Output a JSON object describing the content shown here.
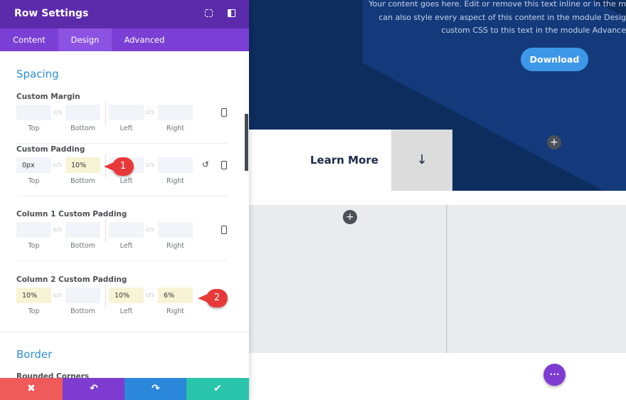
{
  "panel": {
    "title": "Row Settings",
    "tabs": [
      {
        "label": "Content"
      },
      {
        "label": "Design"
      },
      {
        "label": "Advanced"
      }
    ],
    "spacing_title": "Spacing",
    "groups": [
      {
        "label": "Custom Margin",
        "values": [
          "",
          "",
          "",
          ""
        ]
      },
      {
        "label": "Custom Padding",
        "values": [
          "0px",
          "10%",
          "",
          ""
        ]
      },
      {
        "label": "Column 1 Custom Padding",
        "values": [
          "",
          "",
          "",
          ""
        ]
      },
      {
        "label": "Column 2 Custom Padding",
        "values": [
          "10%",
          "",
          "10%",
          "6%"
        ]
      }
    ],
    "sides": [
      "Top",
      "Bottom",
      "Left",
      "Right"
    ],
    "border_title": "Border",
    "rounded_corners": "Rounded Corners",
    "buttons": {
      "cancel": "✖",
      "undo": "↶",
      "redo": "↷",
      "save": "✔"
    }
  },
  "annotations": [
    "1",
    "2"
  ],
  "canvas": {
    "hero_text": [
      "Your content goes here. Edit or remove this text inline or in the m",
      "can also style every aspect of this content in the module Desig",
      "custom CSS to this text in the module Advance"
    ],
    "download": "Download",
    "learn_more": "Learn More",
    "arrow": "↓",
    "plus": "+",
    "more": "•••"
  },
  "colors": {
    "header": "#5c2bab",
    "tabs": "#7a3fd5",
    "hero": "#0c2d5e",
    "accent": "#2e8fd6",
    "cancel": "#ef5a5a",
    "undo": "#7e3bd0",
    "redo": "#2b87da",
    "save": "#29c4a9"
  }
}
